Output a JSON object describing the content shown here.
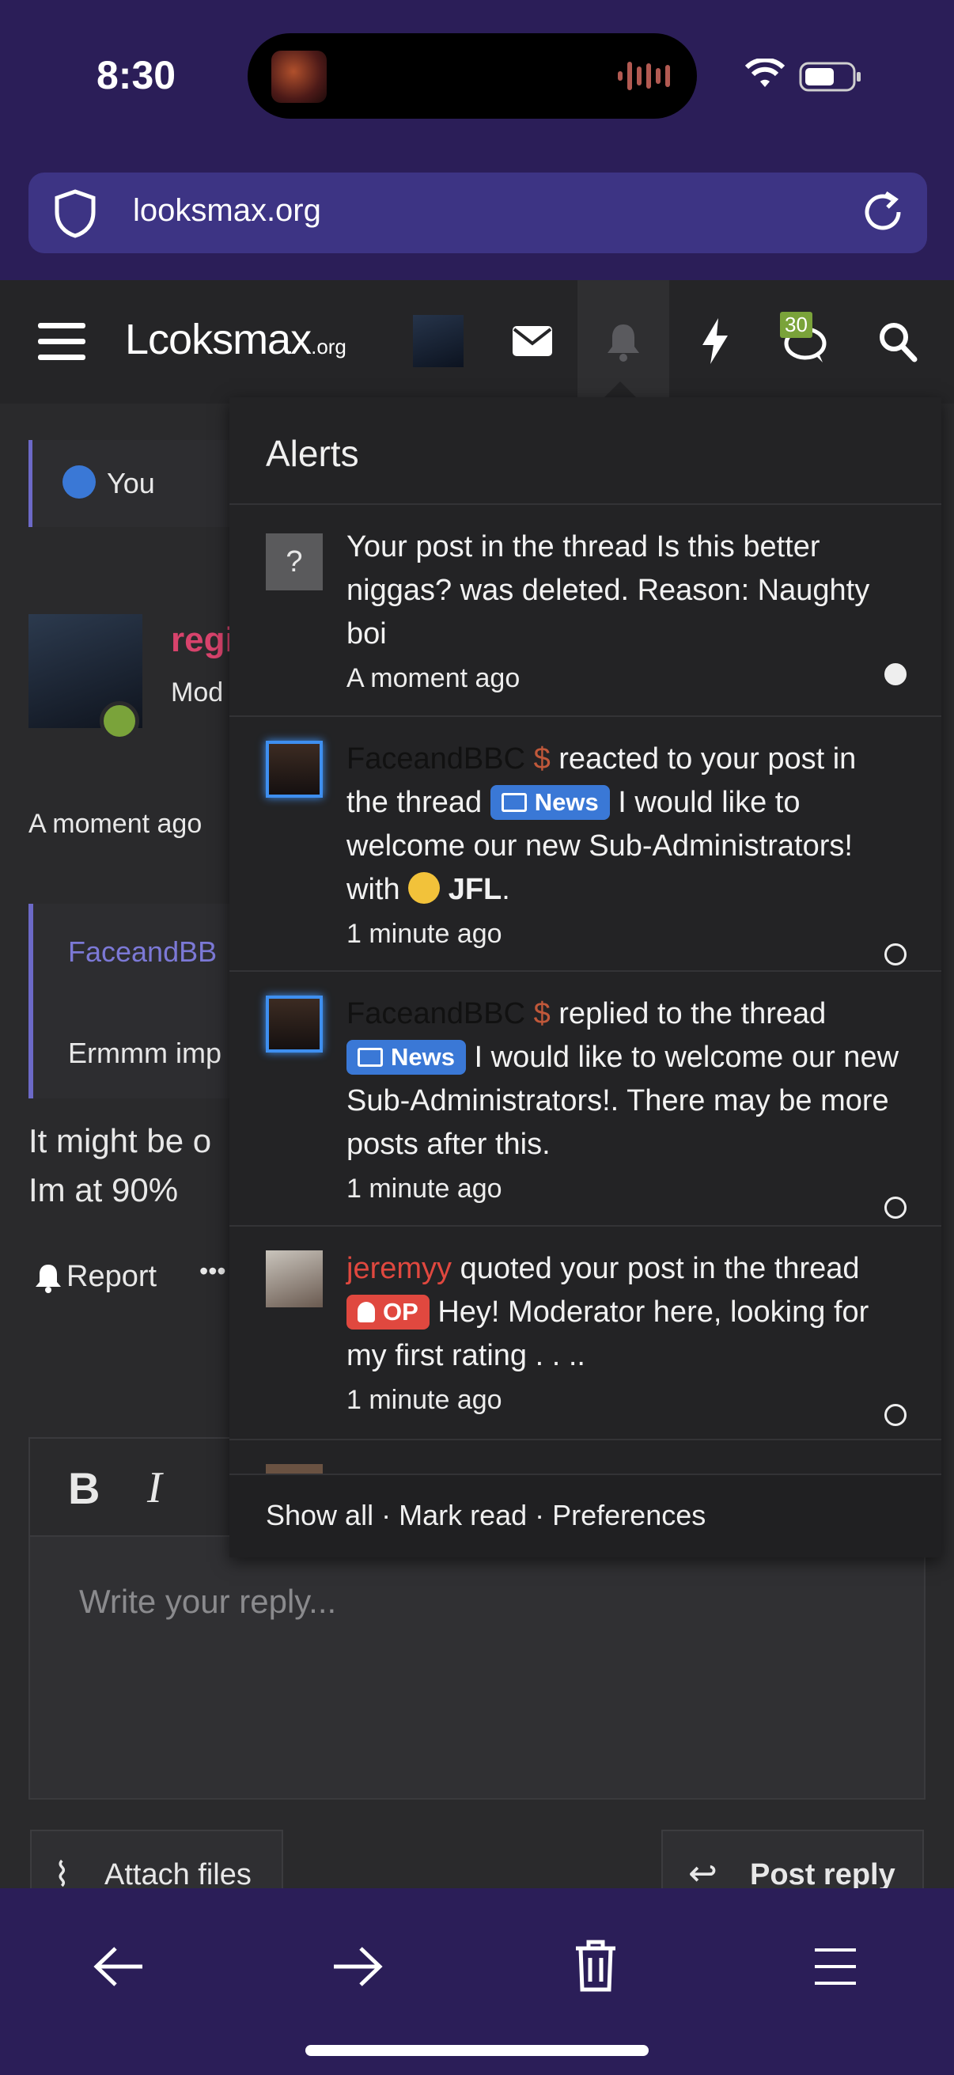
{
  "status_bar": {
    "time": "8:30"
  },
  "browser": {
    "url": "looksmax.org",
    "bottom_nav": [
      "back-icon",
      "forward-icon",
      "trash-icon",
      "menu-icon"
    ]
  },
  "forum_header": {
    "logo": "Lcoksmax",
    "logo_suffix": ".org",
    "notification_count": "30"
  },
  "page": {
    "like_text": "You",
    "author_name": "regi",
    "author_role": "Mod",
    "post_time": "A moment ago",
    "quote_author": "FaceandBB",
    "quote_text": "Ermmm imp",
    "body_line1": "It might be o",
    "body_line2": "Im at 90%",
    "report_label": "Report",
    "more_label": "•••",
    "editor_placeholder": "Write your reply...",
    "attach_label": "Attach files",
    "post_reply_label": "Post reply"
  },
  "alerts": {
    "title": "Alerts",
    "items": [
      {
        "text": "Your post in the thread Is this better niggas? was deleted. Reason: Naughty boi",
        "time": "A moment ago",
        "unread": true
      },
      {
        "user": "FaceandBBC",
        "action": "reacted to your post in the thread",
        "tag": "News",
        "thread": "I would like to welcome our new Sub-Administrators!",
        "reaction_prefix": "with",
        "reaction": "JFL",
        "reaction_suffix": ".",
        "time": "1 minute ago",
        "unread": false
      },
      {
        "user": "FaceandBBC",
        "action": "replied to the thread",
        "tag": "News",
        "thread": "I would like to welcome our new Sub-Administrators!. There may be more posts after this.",
        "time": "1 minute ago",
        "unread": false
      },
      {
        "user": "jeremyy",
        "action": "quoted your post in the thread",
        "tag": "OP",
        "thread": "Hey! Moderator here, looking for my first rating . . ..",
        "time": "1 minute ago",
        "unread": false
      }
    ],
    "footer": {
      "show_all": "Show all",
      "mark_read": "Mark read",
      "preferences": "Preferences",
      "separator": " · "
    }
  },
  "colors": {
    "browser_chrome": "#2b1e58",
    "url_bar": "#3d3484",
    "news_tag": "#3a78d6",
    "op_tag": "#e0483f",
    "online_dot": "#7aa33a"
  }
}
